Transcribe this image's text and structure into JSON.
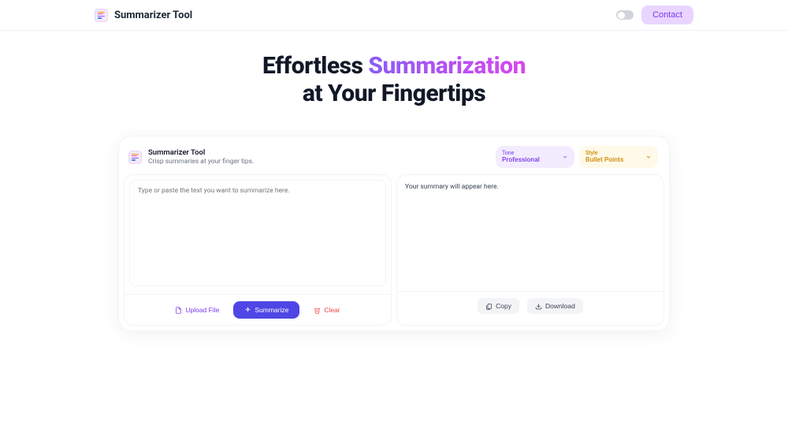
{
  "header": {
    "brand": "Summarizer Tool",
    "contact": "Contact"
  },
  "hero": {
    "line1_prefix": "Effortless ",
    "line1_highlight": "Summarization",
    "line2": "at Your Fingertips"
  },
  "card": {
    "title": "Summarizer Tool",
    "subtitle": "Crisp summaries at your finger tips.",
    "tone_label": "Tone",
    "tone_value": "Professional",
    "style_label": "Style",
    "style_value": "Bullet Points"
  },
  "input": {
    "placeholder": "Type or paste the text you want to summarize here.",
    "upload": "Upload File",
    "summarize": "Summarize",
    "clear": "Clear"
  },
  "output": {
    "placeholder": "Your summary will appear here.",
    "copy": "Copy",
    "download": "Download"
  }
}
